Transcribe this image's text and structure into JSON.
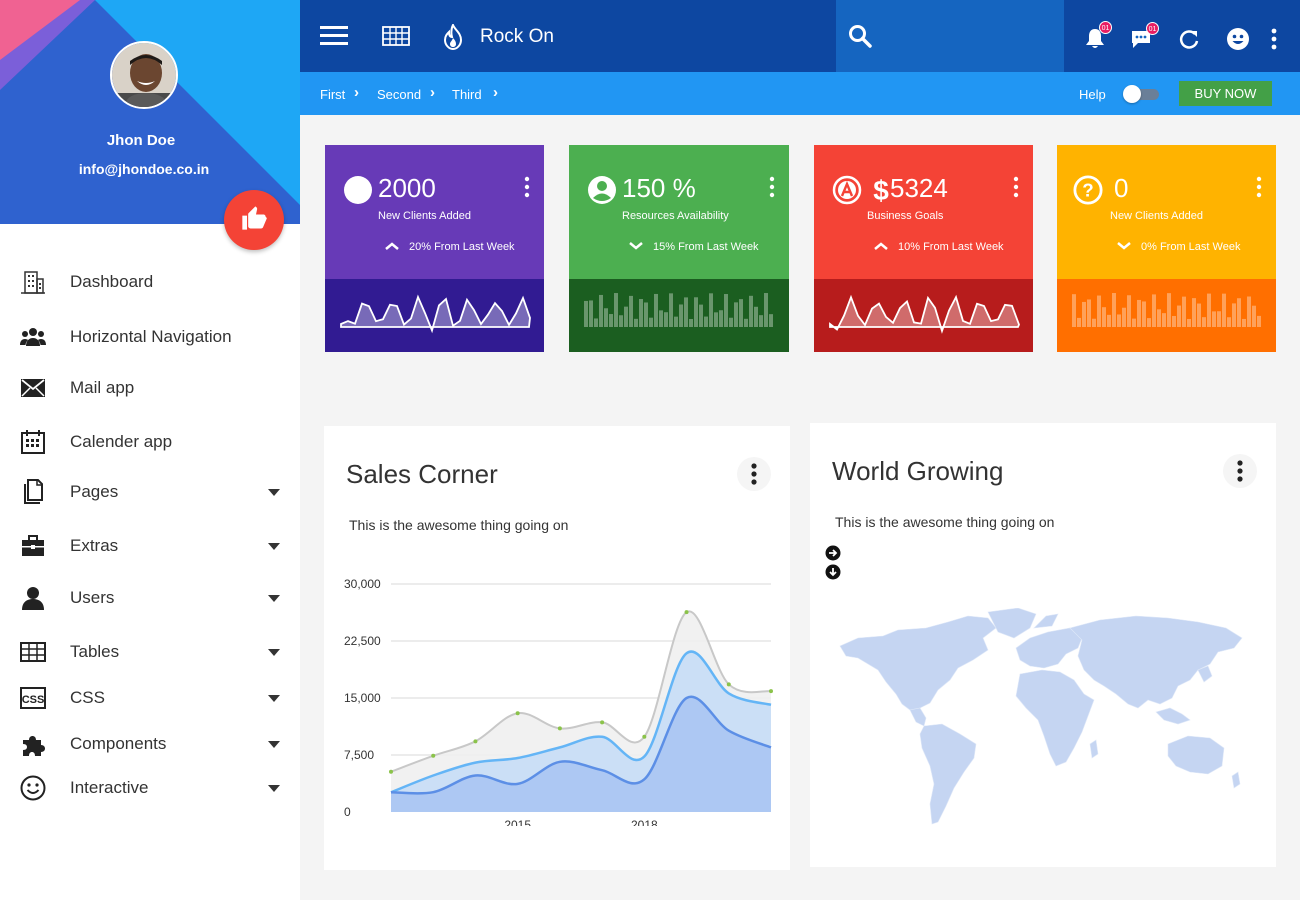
{
  "profile": {
    "name": "Jhon Doe",
    "email": "info@jhondoe.co.in"
  },
  "nav": [
    {
      "label": "Dashboard",
      "icon": "building-icon",
      "has_caret": false
    },
    {
      "label": "Horizontal Navigation",
      "icon": "users-group-icon",
      "has_caret": false
    },
    {
      "label": "Mail app",
      "icon": "envelope-icon",
      "has_caret": false
    },
    {
      "label": "Calender app",
      "icon": "calendar-icon",
      "has_caret": false
    },
    {
      "label": "Pages",
      "icon": "pages-icon",
      "has_caret": true
    },
    {
      "label": "Extras",
      "icon": "briefcase-icon",
      "has_caret": true
    },
    {
      "label": "Users",
      "icon": "user-icon",
      "has_caret": true
    },
    {
      "label": "Tables",
      "icon": "table-icon",
      "has_caret": true
    },
    {
      "label": "CSS",
      "icon": "css-icon",
      "has_caret": true
    },
    {
      "label": "Components",
      "icon": "puzzle-icon",
      "has_caret": true
    },
    {
      "label": "Interactive",
      "icon": "smiley-icon",
      "has_caret": true
    }
  ],
  "topbar": {
    "title": "Rock On",
    "notifications_badge": "01",
    "messages_badge": "01"
  },
  "breadcrumb": [
    "First",
    "Second",
    "Third"
  ],
  "help_label": "Help",
  "buy_label": "BUY NOW",
  "cards": [
    {
      "value": "2000",
      "label": "New Clients Added",
      "trend": "20% From Last Week",
      "trend_dir": "up",
      "color": "#673ab7",
      "dark": "#311b92"
    },
    {
      "value": "150 %",
      "label": "Resources Availability",
      "trend": "15% From Last Week",
      "trend_dir": "down",
      "color": "#4caf50",
      "dark": "#1b5e20"
    },
    {
      "value": "5324",
      "label": "Business Goals",
      "trend": "10% From Last Week",
      "trend_dir": "up",
      "color": "#f44336",
      "dark": "#b71c1c"
    },
    {
      "value": "0",
      "label": "New Clients Added",
      "trend": "0% From Last Week",
      "trend_dir": "down",
      "color": "#ffb300",
      "dark": "#ff6f00"
    }
  ],
  "sales": {
    "title": "Sales Corner",
    "subtitle": "This is the awesome thing going on"
  },
  "world": {
    "title": "World Growing",
    "subtitle": "This is the awesome thing going on"
  },
  "chart_data": {
    "type": "area",
    "title": "",
    "xlabel": "",
    "ylabel": "",
    "x": [
      2012,
      2013,
      2014,
      2015,
      2016,
      2017,
      2018,
      2019,
      2020,
      2021
    ],
    "x_tick_labels": [
      "2015",
      "2018"
    ],
    "y_ticks": [
      "30,000",
      "22,500",
      "15,000",
      "7,500",
      "0"
    ],
    "ylim": [
      0,
      30000
    ],
    "grid": true,
    "series": [
      {
        "values": [
          5300,
          7400,
          9300,
          13000,
          11000,
          11800,
          9900,
          26300,
          16800,
          15900
        ],
        "color": "#c8c8c8"
      },
      {
        "values": [
          2600,
          4800,
          6500,
          7100,
          8500,
          9900,
          7300,
          20900,
          15600,
          14100
        ],
        "color": "#64b5f6"
      },
      {
        "values": [
          2600,
          2600,
          4800,
          3700,
          6600,
          5500,
          4300,
          15000,
          10700,
          8500
        ],
        "color": "#5c8fe6"
      }
    ]
  }
}
